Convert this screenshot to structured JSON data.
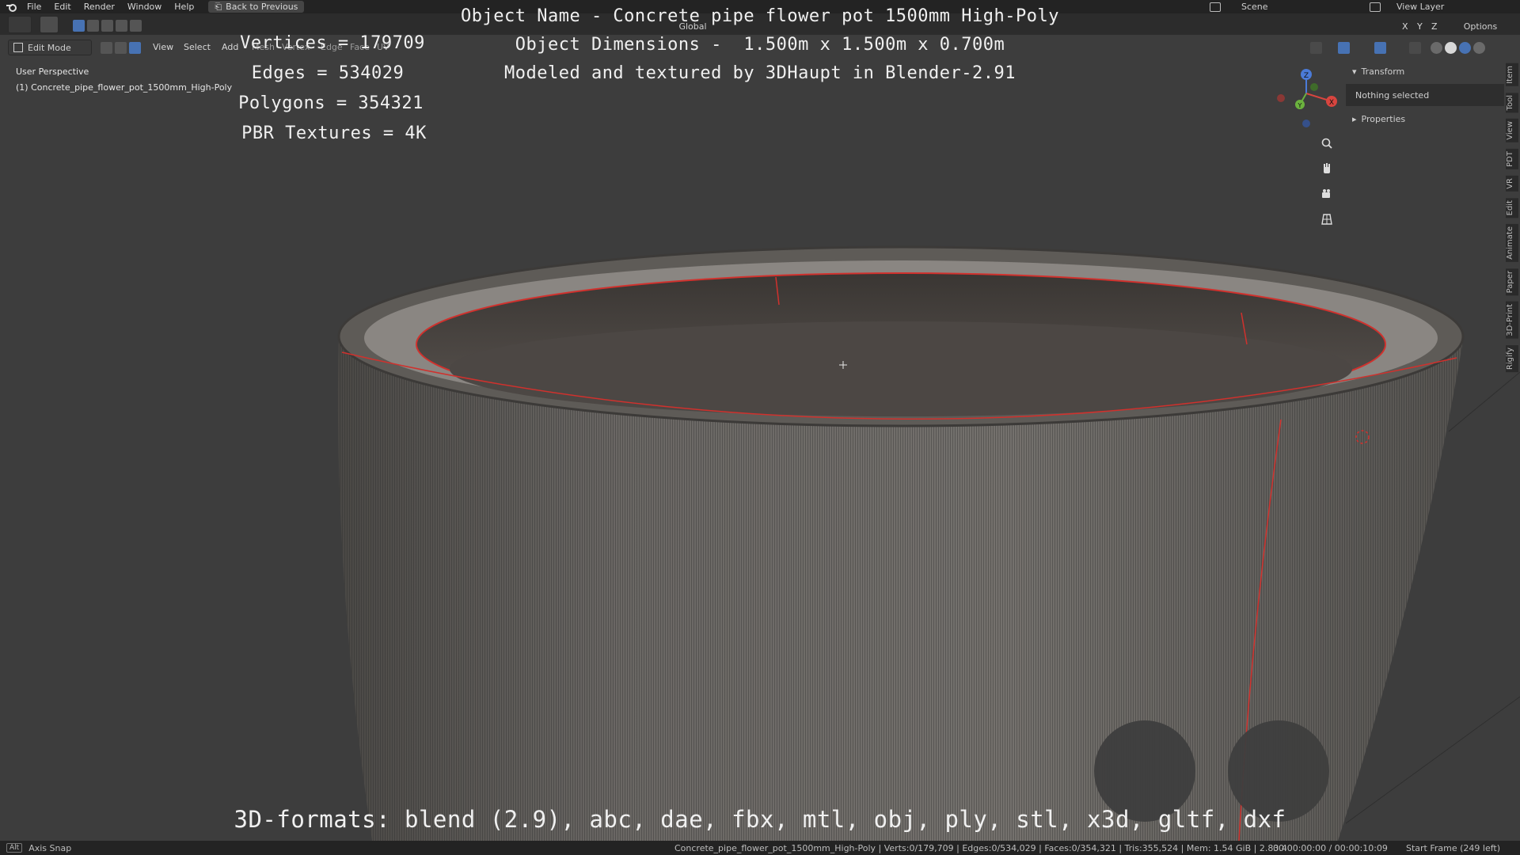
{
  "topbar": {
    "menus": [
      "File",
      "Edit",
      "Render",
      "Window",
      "Help"
    ],
    "back_button": "Back to Previous",
    "scene_label": "Scene",
    "view_layer_label": "View Layer"
  },
  "toolbar": {
    "orientation": "Global",
    "options_label": "Options",
    "axes": [
      "X",
      "Y",
      "Z"
    ]
  },
  "header": {
    "mode": "Edit Mode",
    "menus": [
      "View",
      "Select",
      "Add",
      "Mesh",
      "Vertex",
      "Edge",
      "Face",
      "UV"
    ]
  },
  "viewport": {
    "perspective_label": "User Perspective",
    "object_label": "(1) Concrete_pipe_flower_pot_1500mm_High-Poly"
  },
  "overlay": {
    "vertices": "Vertices = 179709",
    "edges": "Edges = 534029",
    "polygons": "Polygons = 354321",
    "textures": "PBR Textures = 4K",
    "object_name": "Object Name - Concrete pipe flower pot 1500mm High-Poly",
    "dimensions": "Object Dimensions -  1.500m x 1.500m x 0.700m",
    "credit": "Modeled and textured by 3DHaupt in Blender-2.91",
    "formats": "3D-formats: blend (2.9), abc, dae, fbx, mtl, obj, ply, stl, x3d, gltf, dxf"
  },
  "npanel": {
    "transform_label": "Transform",
    "nothing_selected": "Nothing selected",
    "properties_label": "Properties",
    "tabs": [
      "Item",
      "Tool",
      "View",
      "PDT",
      "VR",
      "Edit",
      "Animate",
      "Paper",
      "3D-Print",
      "Rigify"
    ]
  },
  "gizmo": {
    "axis_x": "X",
    "axis_y": "Y",
    "axis_z": "Z"
  },
  "statusbar": {
    "key_hint": "Alt",
    "axis_snap": "Axis Snap",
    "stats": "Concrete_pipe_flower_pot_1500mm_High-Poly | Verts:0/179,709 | Edges:0/534,029 | Faces:0/354,321 | Tris:355,524 | Mem: 1.54 GiB | 2.83.4",
    "time": "00:00:00:00 / 00:00:10:09",
    "start_frame": "Start Frame (249 left)"
  },
  "colors": {
    "viewport_bg": "#3d3d3d",
    "edge_seam": "#d0312d",
    "accent": "#4772b3"
  }
}
